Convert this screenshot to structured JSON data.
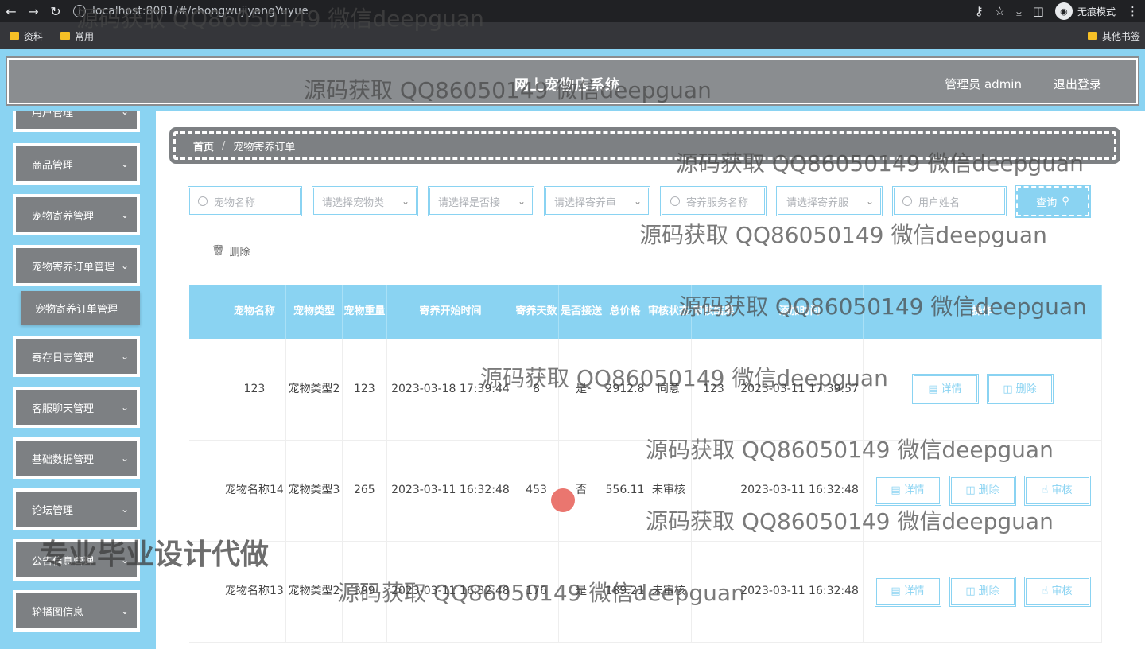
{
  "browser": {
    "url": "localhost:8081/#/chongwujiyangYuyue",
    "incognito_label": "无痕模式",
    "bookmarks": [
      "资料",
      "常用"
    ],
    "other_bookmarks": "其他书签"
  },
  "header": {
    "title": "网上宠物店系统",
    "admin_label": "管理员 admin",
    "logout_label": "退出登录"
  },
  "sidebar": {
    "items": [
      {
        "label": "用户管理"
      },
      {
        "label": "商品管理"
      },
      {
        "label": "宠物寄养管理"
      },
      {
        "label": "宠物寄养订单管理"
      },
      {
        "label": "寄存日志管理"
      },
      {
        "label": "客服聊天管理"
      },
      {
        "label": "基础数据管理"
      },
      {
        "label": "论坛管理"
      },
      {
        "label": "公告信息管理"
      },
      {
        "label": "轮播图信息"
      }
    ],
    "active_sub": "宠物寄养订单管理"
  },
  "breadcrumb": {
    "home": "首页",
    "sep": "/",
    "current": "宠物寄养订单"
  },
  "filters": {
    "pet_name": "宠物名称",
    "pet_type": "请选择宠物类",
    "pickup": "请选择是否接",
    "status": "请选择寄养审",
    "service": "寄养服务名称",
    "service_type": "请选择寄养服",
    "user_name": "用户姓名",
    "search_label": "查询"
  },
  "toolbar": {
    "delete_label": "删除"
  },
  "table": {
    "headers": [
      "宠物名称",
      "宠物类型",
      "宠物重量",
      "寄养开始时间",
      "寄养天数",
      "是否接送",
      "总价格",
      "审核状态",
      "审核结果",
      "添加时间",
      "操作"
    ],
    "rows": [
      {
        "name": "123",
        "type": "宠物类型2",
        "weight": "123",
        "start": "2023-03-18 17:39:44",
        "days": "8",
        "pickup": "是",
        "price": "2912.8",
        "status": "同意",
        "result": "123",
        "added": "2023-03-11 17:39:57",
        "ops": [
          "详情",
          "删除"
        ]
      },
      {
        "name": "宠物名称14",
        "type": "宠物类型3",
        "weight": "265",
        "start": "2023-03-11 16:32:48",
        "days": "453",
        "pickup": "否",
        "price": "556.11",
        "status": "未审核",
        "result": "",
        "added": "2023-03-11 16:32:48",
        "ops": [
          "详情",
          "删除",
          "审核"
        ]
      },
      {
        "name": "宠物名称13",
        "type": "宠物类型2",
        "weight": "399",
        "start": "2023-03-11 16:32:48",
        "days": "176",
        "pickup": "是",
        "price": "189.21",
        "status": "未审核",
        "result": "",
        "added": "2023-03-11 16:32:48",
        "ops": [
          "详情",
          "删除",
          "审核"
        ]
      }
    ]
  },
  "watermarks": {
    "qq": "源码获取 QQ86050149 微信deepguan",
    "promo": "专业毕业设计代做"
  }
}
